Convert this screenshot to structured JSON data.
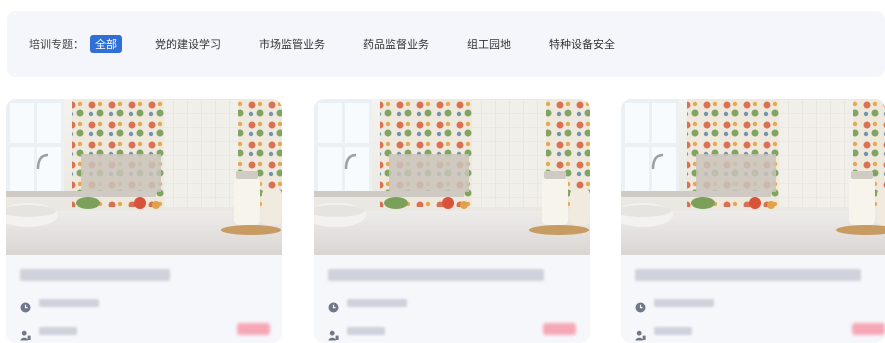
{
  "filter": {
    "label": "培训专题：",
    "items": [
      {
        "label": "全部",
        "active": true
      },
      {
        "label": "党的建设学习",
        "active": false
      },
      {
        "label": "市场监管业务",
        "active": false
      },
      {
        "label": "药品监督业务",
        "active": false
      },
      {
        "label": "组工园地",
        "active": false
      },
      {
        "label": "特种设备安全",
        "active": false
      }
    ]
  },
  "colors": {
    "accent": "#2f6fd6",
    "filter_bg": "#f4f6fb",
    "card_bg": "#f6f7fb",
    "badge": "#f6a7b6"
  },
  "cards": [
    {
      "thumbnail": "kitchen-counter-photo",
      "date_icon": "clock-icon",
      "people_icon": "person-icon"
    },
    {
      "thumbnail": "kitchen-counter-photo",
      "date_icon": "clock-icon",
      "people_icon": "person-icon"
    },
    {
      "thumbnail": "kitchen-counter-photo",
      "date_icon": "clock-icon",
      "people_icon": "person-icon"
    }
  ]
}
